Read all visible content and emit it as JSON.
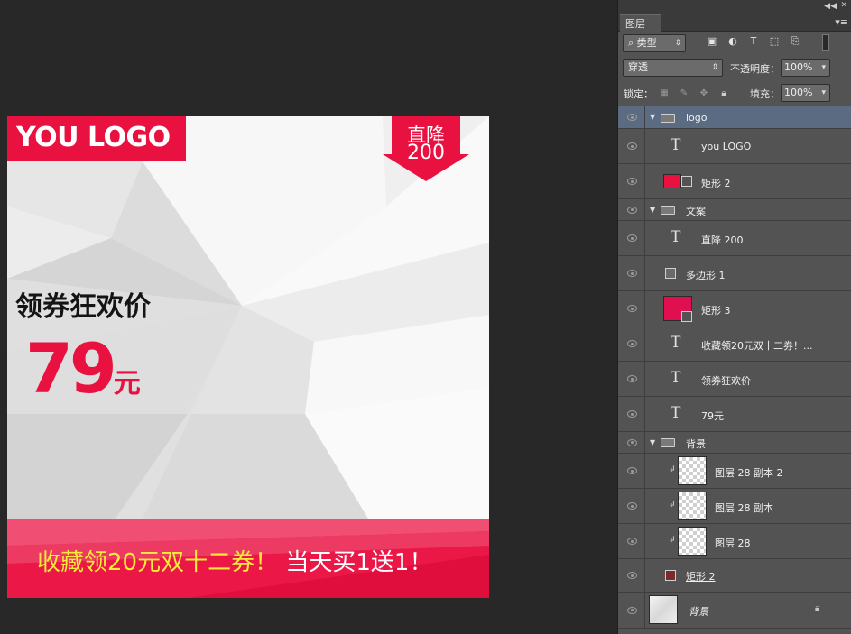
{
  "canvas": {
    "logo_text": "YOU LOGO",
    "tag_line1": "直降",
    "tag_line2": "200",
    "headline": "领券狂欢价",
    "price_number": "79",
    "price_unit": "元",
    "bottom_yellow": "收藏领20元双十二券！",
    "bottom_white": "当天买1送1！",
    "colors": {
      "accent": "#e8113f",
      "yellow": "#f6ea3a",
      "background": "#282828"
    }
  },
  "panel": {
    "tab_label": "图层",
    "filter_label": "类型",
    "blend_mode": "穿透",
    "opacity_label": "不透明度：",
    "opacity_value": "100%",
    "lock_label": "锁定：",
    "fill_label": "填充：",
    "fill_value": "100%",
    "layers": [
      {
        "name": "logo",
        "kind": "group",
        "selected": true
      },
      {
        "name": "you LOGO",
        "kind": "text"
      },
      {
        "name": "矩形 2",
        "kind": "shape-red"
      },
      {
        "name": "文案",
        "kind": "group"
      },
      {
        "name": "直降 200",
        "kind": "text"
      },
      {
        "name": "多边形 1",
        "kind": "shape-small"
      },
      {
        "name": "矩形 3",
        "kind": "shape-red"
      },
      {
        "name": "收藏领20元双十二券！...",
        "kind": "text"
      },
      {
        "name": "领券狂欢价",
        "kind": "text"
      },
      {
        "name": "79元",
        "kind": "text"
      },
      {
        "name": "背景",
        "kind": "group"
      },
      {
        "name": "图层 28 副本 2",
        "kind": "pixel-clip"
      },
      {
        "name": "图层 28 副本",
        "kind": "pixel-clip"
      },
      {
        "name": "图层 28",
        "kind": "pixel-clip"
      },
      {
        "name": "矩形 2",
        "kind": "shape-small-underline"
      },
      {
        "name": "背景",
        "kind": "background-locked"
      }
    ]
  }
}
